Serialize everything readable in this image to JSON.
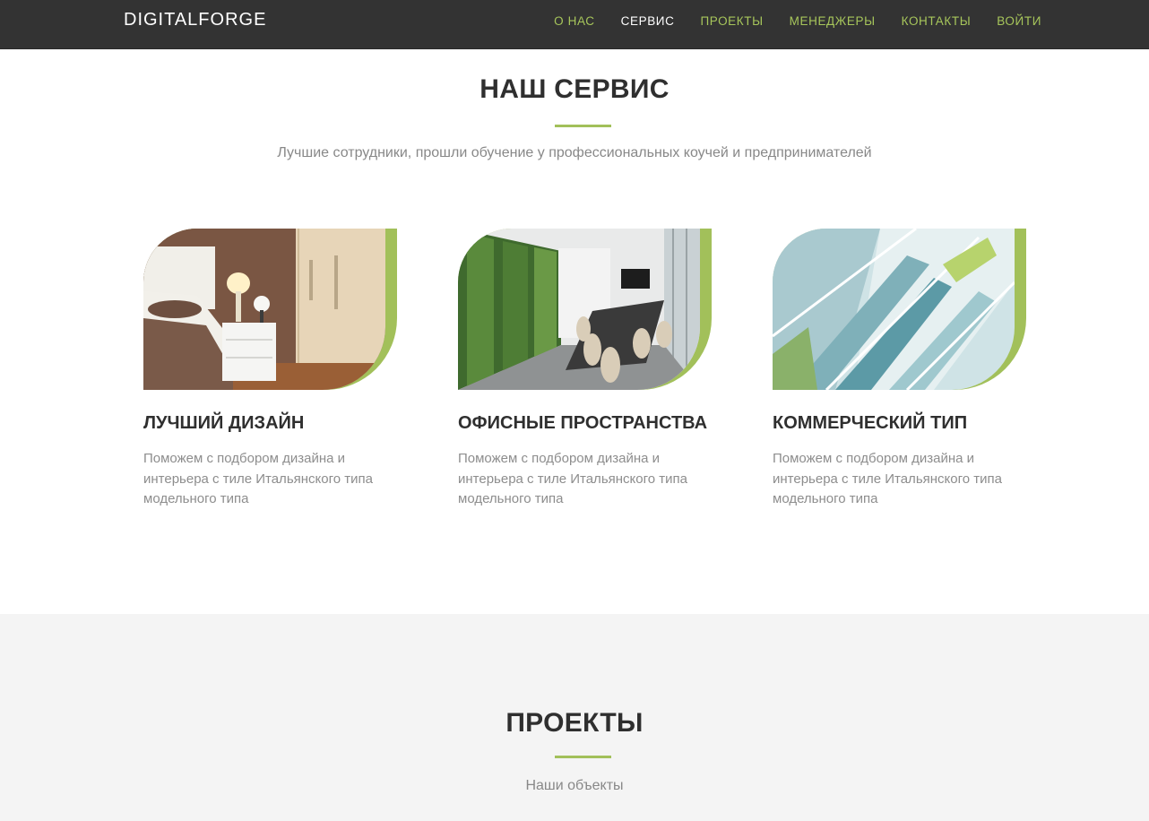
{
  "nav": {
    "brand": "DIGITALFORGE",
    "items": [
      {
        "label": "О НАС",
        "active": false
      },
      {
        "label": "СЕРВИС",
        "active": true
      },
      {
        "label": "ПРОЕКТЫ",
        "active": false
      },
      {
        "label": "МЕНЕДЖЕРЫ",
        "active": false
      },
      {
        "label": "КОНТАКТЫ",
        "active": false
      },
      {
        "label": "ВОЙТИ",
        "active": false
      }
    ]
  },
  "service": {
    "title": "НАШ СЕРВИС",
    "subtitle": "Лучшие сотрудники, прошли обучение у профессиональных коучей и предпринимателей",
    "cards": [
      {
        "title": "ЛУЧШИЙ ДИЗАЙН",
        "text": "Поможем с подбором дизайна и интерьера с тиле Итальянского типа модельного типа",
        "image": "bedroom-photo"
      },
      {
        "title": "ОФИСНЫЕ ПРОСТРАНСТВА",
        "text": "Поможем с подбором дизайна и интерьера с тиле Итальянского типа модельного типа",
        "image": "conference-room-photo"
      },
      {
        "title": "КОММЕРЧЕСКИЙ ТИП",
        "text": "Поможем с подбором дизайна и интерьера с тиле Итальянского типа модельного типа",
        "image": "escalator-photo"
      }
    ]
  },
  "projects": {
    "title": "ПРОЕКТЫ",
    "subtitle": "Наши объекты"
  },
  "colors": {
    "accent": "#a2c05a",
    "nav_link": "#a7c65b",
    "navbar_bg": "#333333",
    "section_alt_bg": "#f4f4f4"
  }
}
